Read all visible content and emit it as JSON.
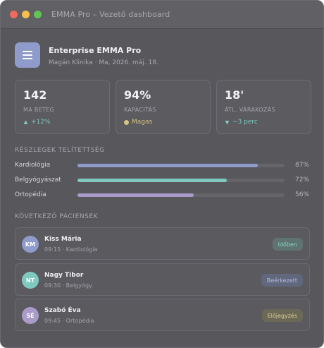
{
  "window": {
    "title": "EMMA Pro – Vezető dashboard"
  },
  "header": {
    "org_name": "Enterprise EMMA Pro",
    "org_sub": "Magán Klinika · Ma, 2026. máj. 18.",
    "icon": "menu-icon"
  },
  "stats": [
    {
      "value": "142",
      "label": "MA BETEG",
      "delta": "+12%",
      "delta_icon": "arrow-up-icon",
      "color": "#7fc9c0"
    },
    {
      "value": "94%",
      "label": "KAPACITÁS",
      "delta": "Magas",
      "delta_icon": "dot-icon",
      "color": "#d8c27f"
    },
    {
      "value": "18'",
      "label": "ÁTL. VÁRAKOZÁS",
      "delta": "−3 perc",
      "delta_icon": "arrow-down-icon",
      "color": "#7fc9c0"
    }
  ],
  "departments": {
    "title": "RÉSZLEGEK TELÍTETTSÉG",
    "items": [
      {
        "name": "Kardiológia",
        "pct_label": "87%",
        "fraction": 0.87,
        "color": "#8f9ccb"
      },
      {
        "name": "Belgyógyászat",
        "pct_label": "72%",
        "fraction": 0.72,
        "color": "#7fc9c0"
      },
      {
        "name": "Ortopédia",
        "pct_label": "56%",
        "fraction": 0.56,
        "color": "#a99cc8"
      }
    ]
  },
  "patients": {
    "title": "KÖVETKEZŐ PÁCIENSEK",
    "items": [
      {
        "initials": "KM",
        "name": "Kiss Mária",
        "meta": "09:15 · Kardiológia",
        "status": "Időben",
        "avatar_color": "#8f9ccb",
        "badge_bg": "#5f7471",
        "badge_color": "#8fd3ca"
      },
      {
        "initials": "NT",
        "name": "Nagy Tibor",
        "meta": "09:30 · Belgyógy.",
        "status": "Beérkezett",
        "avatar_color": "#7fc9c0",
        "badge_bg": "#61677c",
        "badge_color": "#b4bde0"
      },
      {
        "initials": "SÉ",
        "name": "Szabó Éva",
        "meta": "09:45 · Ortopédia",
        "status": "Előjegyzés",
        "avatar_color": "#a99cc8",
        "badge_bg": "#6b6858",
        "badge_color": "#e0cf92"
      }
    ]
  }
}
